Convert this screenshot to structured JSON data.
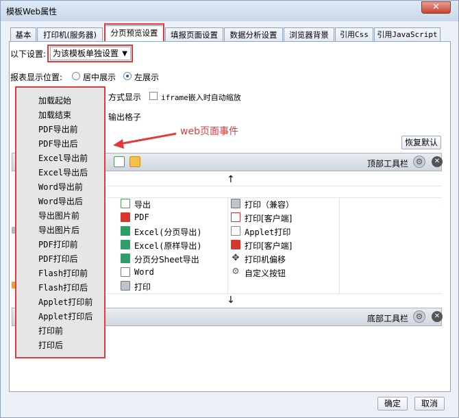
{
  "window": {
    "title": "模板Web属性",
    "close_glyph": "✕"
  },
  "tabs": [
    {
      "label": "基本"
    },
    {
      "label": "打印机(服务器)"
    },
    {
      "label": "分页预览设置"
    },
    {
      "label": "填报页面设置"
    },
    {
      "label": "数据分析设置"
    },
    {
      "label": "浏览器背景"
    },
    {
      "label": "引用Css"
    },
    {
      "label": "引用JavaScript"
    }
  ],
  "settings": {
    "label": "以下设置:",
    "select_value": "为该模板单独设置",
    "position_label": "报表显示位置:",
    "position_options": [
      "居中展示",
      "左展示"
    ],
    "position_selected": "左展示",
    "show_mode_suffix": "方式显示",
    "iframe_label": "iframe嵌入时自动缩放",
    "export_grid_suffix": "输出格子",
    "restore_default": "恢复默认"
  },
  "toolbars": {
    "top_label": "顶部工具栏",
    "bottom_label": "底部工具栏"
  },
  "toolbar_items_left": [
    {
      "label": "导出",
      "icon": "export-icon"
    },
    {
      "label": "PDF",
      "icon": "pdf-icon"
    },
    {
      "label": "Excel(分页导出)",
      "icon": "excel-icon"
    },
    {
      "label": "Excel(原样导出)",
      "icon": "excel-icon"
    },
    {
      "label": "分页分Sheet导出",
      "icon": "excel-icon"
    },
    {
      "label": "Word",
      "icon": "word-icon"
    },
    {
      "label": "打印",
      "icon": "print-icon"
    }
  ],
  "toolbar_items_right": [
    {
      "label": "打印（兼容）",
      "icon": "print-icon"
    },
    {
      "label": "打印[客户端]",
      "icon": "client-print-icon"
    },
    {
      "label": "Applet打印",
      "icon": "applet-icon"
    },
    {
      "label": "打印[客户端]",
      "icon": "pdf-print-icon"
    },
    {
      "label": "打印机偏移",
      "icon": "move-icon"
    },
    {
      "label": "自定义按钮",
      "icon": "gear-icon"
    }
  ],
  "events_menu": [
    "加载起始",
    "加载结束",
    "PDF导出前",
    "PDF导出后",
    "Excel导出前",
    "Excel导出后",
    "Word导出前",
    "Word导出后",
    "导出图片前",
    "导出图片后",
    "PDF打印前",
    "PDF打印后",
    "Flash打印前",
    "Flash打印后",
    "Applet打印前",
    "Applet打印后",
    "打印前",
    "打印后"
  ],
  "annotation": "web页面事件",
  "footer": {
    "ok": "确定",
    "cancel": "取消"
  },
  "colors": {
    "highlight": "#e23a3a",
    "excel": "#2f9e6a",
    "pdf": "#d9362b"
  }
}
